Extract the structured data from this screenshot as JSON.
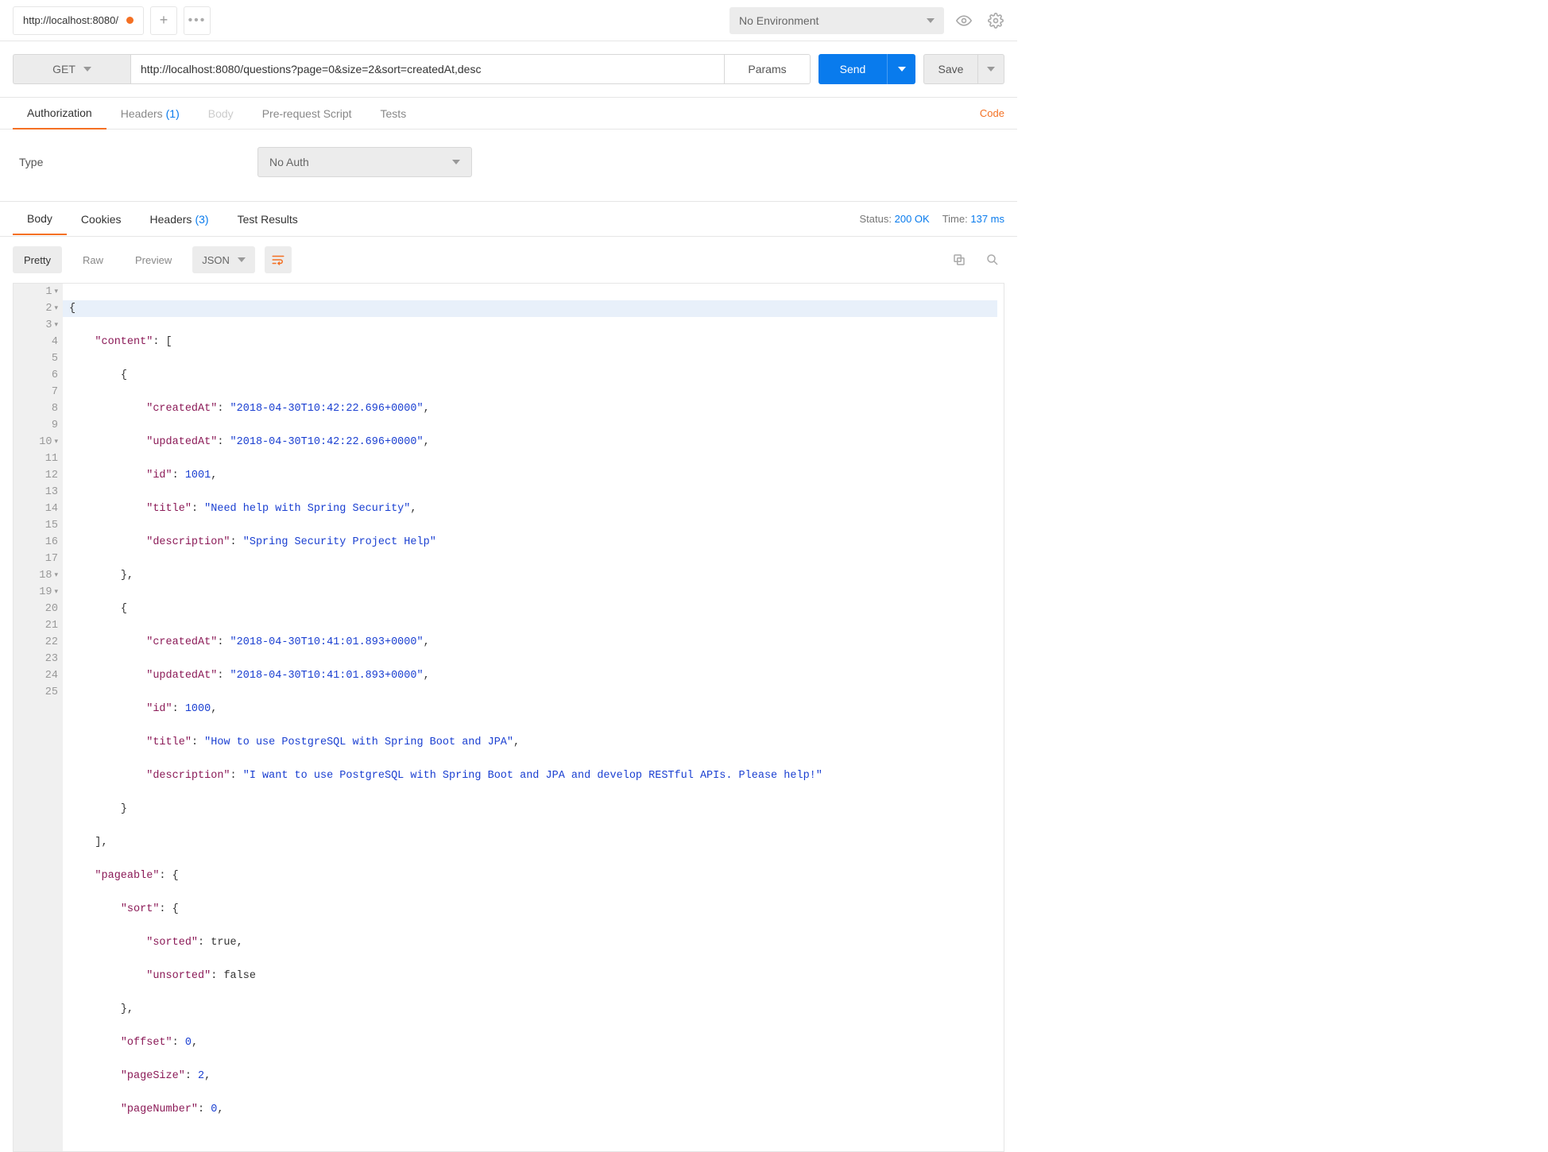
{
  "topbar": {
    "tab_title": "http://localhost:8080/",
    "env_label": "No Environment"
  },
  "request": {
    "method": "GET",
    "url": "http://localhost:8080/questions?page=0&size=2&sort=createdAt,desc",
    "params_label": "Params",
    "send_label": "Send",
    "save_label": "Save"
  },
  "req_tabs": {
    "authorization": "Authorization",
    "headers": "Headers",
    "headers_count": "(1)",
    "body": "Body",
    "prerequest": "Pre-request Script",
    "tests": "Tests",
    "code": "Code"
  },
  "auth": {
    "type_label": "Type",
    "value": "No Auth"
  },
  "resp_tabs": {
    "body": "Body",
    "cookies": "Cookies",
    "headers": "Headers",
    "headers_count": "(3)",
    "test_results": "Test Results",
    "status_label": "Status:",
    "status_value": "200 OK",
    "time_label": "Time:",
    "time_value": "137 ms"
  },
  "resp_toolbar": {
    "pretty": "Pretty",
    "raw": "Raw",
    "preview": "Preview",
    "format": "JSON"
  },
  "code_lines": {
    "l1": "{",
    "l2": "    \"content\": [",
    "l3": "        {",
    "l4": "            \"createdAt\": \"2018-04-30T10:42:22.696+0000\",",
    "l5": "            \"updatedAt\": \"2018-04-30T10:42:22.696+0000\",",
    "l6": "            \"id\": 1001,",
    "l7": "            \"title\": \"Need help with Spring Security\",",
    "l8": "            \"description\": \"Spring Security Project Help\"",
    "l9": "        },",
    "l10": "        {",
    "l11": "            \"createdAt\": \"2018-04-30T10:41:01.893+0000\",",
    "l12": "            \"updatedAt\": \"2018-04-30T10:41:01.893+0000\",",
    "l13": "            \"id\": 1000,",
    "l14": "            \"title\": \"How to use PostgreSQL with Spring Boot and JPA\",",
    "l15": "            \"description\": \"I want to use PostgreSQL with Spring Boot and JPA and develop RESTful APIs. Please help!\"",
    "l16": "        }",
    "l17": "    ],",
    "l18": "    \"pageable\": {",
    "l19": "        \"sort\": {",
    "l20": "            \"sorted\": true,",
    "l21": "            \"unsorted\": false",
    "l22": "        },",
    "l23": "        \"offset\": 0,",
    "l24": "        \"pageSize\": 2,",
    "l25": "        \"pageNumber\": 0,"
  },
  "line_numbers": {
    "n1": "1",
    "n2": "2",
    "n3": "3",
    "n4": "4",
    "n5": "5",
    "n6": "6",
    "n7": "7",
    "n8": "8",
    "n9": "9",
    "n10": "10",
    "n11": "11",
    "n12": "12",
    "n13": "13",
    "n14": "14",
    "n15": "15",
    "n16": "16",
    "n17": "17",
    "n18": "18",
    "n19": "19",
    "n20": "20",
    "n21": "21",
    "n22": "22",
    "n23": "23",
    "n24": "24",
    "n25": "25"
  }
}
